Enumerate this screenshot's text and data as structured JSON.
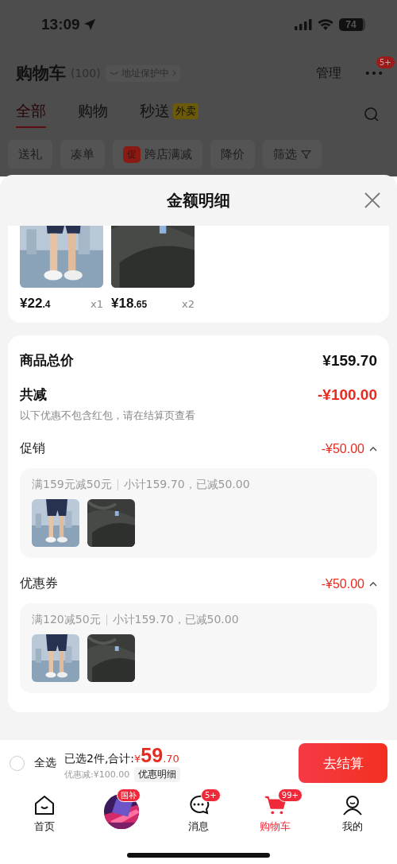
{
  "status_bar": {
    "time": "13:09",
    "battery": "74"
  },
  "header": {
    "title": "购物车",
    "count": "(100)",
    "address_badge": "地址保护中",
    "manage": "管理",
    "more_badge": "5+"
  },
  "tabs": [
    {
      "label": "全部",
      "selected": true
    },
    {
      "label": "购物",
      "selected": false
    },
    {
      "label": "秒送",
      "tag": "外卖",
      "selected": false
    }
  ],
  "filters": [
    {
      "label": "送礼",
      "kind": "plain"
    },
    {
      "label": "凑单",
      "kind": "plain"
    },
    {
      "label": "跨店满减",
      "kind": "tagged",
      "tag": "促"
    },
    {
      "label": "降价",
      "kind": "plain"
    },
    {
      "label": "筛选",
      "kind": "filter"
    }
  ],
  "sheet": {
    "title": "金额明细",
    "items": [
      {
        "kind": "shorts",
        "price_int": "¥22",
        "price_dec": ".4",
        "qty": "x1"
      },
      {
        "kind": "fabric",
        "price_int": "¥18",
        "price_dec": ".65",
        "qty": "x2"
      }
    ],
    "total_label": "商品总价",
    "total": "¥159.70",
    "discount_label": "共减",
    "discount": "-¥100.00",
    "note": "以下优惠不包含红包，请在结算页查看",
    "groups": [
      {
        "label": "促销",
        "amount": "-¥50.00",
        "expanded": true,
        "rule": "满159元减50元",
        "detail": "小计159.70，已减50.00",
        "products": [
          {
            "kind": "shorts"
          },
          {
            "kind": "fabric"
          }
        ]
      },
      {
        "label": "优惠券",
        "amount": "-¥50.00",
        "expanded": true,
        "rule": "满120减50元",
        "detail": "小计159.70，已减50.00",
        "products": [
          {
            "kind": "shorts"
          },
          {
            "kind": "fabric"
          }
        ]
      }
    ]
  },
  "bottom_bar": {
    "select_all": {
      "label": "全选",
      "checked": false
    },
    "selected_text": "已选2件,合计:",
    "currency": "¥",
    "total_int": "59",
    "total_dec": ".70",
    "discount": "优惠减:¥100.00",
    "detail_button": "优惠明细",
    "checkout": "去结算"
  },
  "nav": [
    {
      "kind": "home",
      "label": "首页",
      "selected": false
    },
    {
      "kind": "promo",
      "badge": "国补",
      "selected": false
    },
    {
      "kind": "message",
      "label": "消息",
      "badge": "5+",
      "selected": false
    },
    {
      "kind": "cart",
      "label": "购物车",
      "badge": "99+",
      "selected": true
    },
    {
      "kind": "profile",
      "label": "我的",
      "selected": false
    }
  ]
}
